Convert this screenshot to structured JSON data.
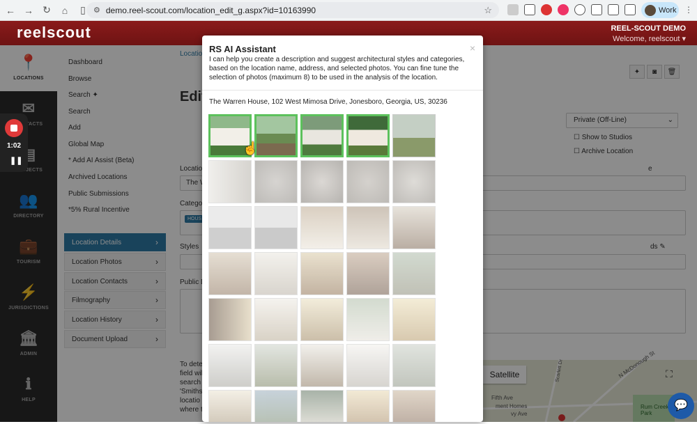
{
  "browser": {
    "url": "demo.reel-scout.com/location_edit_g.aspx?id=10163990",
    "profile_label": "Work"
  },
  "header": {
    "logo": "reelscout",
    "org": "REEL-SCOUT DEMO",
    "welcome": "Welcome, reelscout ▾"
  },
  "rail": [
    {
      "label": "LOCATIONS",
      "icon": "location-pin-icon"
    },
    {
      "label": "CONTACTS",
      "icon": "envelope-icon"
    },
    {
      "label": "PROJECTS",
      "icon": "projects-icon"
    },
    {
      "label": "DIRECTORY",
      "icon": "people-icon"
    },
    {
      "label": "TOURISM",
      "icon": "suitcase-icon"
    },
    {
      "label": "JURISDICTIONS",
      "icon": "lightning-icon"
    },
    {
      "label": "ADMIN",
      "icon": "building-icon"
    },
    {
      "label": "HELP",
      "icon": "info-icon"
    }
  ],
  "recorder": {
    "time": "1:02"
  },
  "sidebar": {
    "links": [
      "Dashboard",
      "Browse",
      "Search ✦",
      "Search",
      "Add",
      "Global Map",
      "* Add AI Assist (Beta)",
      "Archived Locations",
      "Public Submissions",
      "*5% Rural Incentive"
    ],
    "buttons": [
      "Location Details",
      "Location Photos",
      "Location Contacts",
      "Filmography",
      "Location History",
      "Document Upload"
    ]
  },
  "background": {
    "breadcrumb": "Locatio",
    "heading": "Edit",
    "status_select": "Private (Off-Line)",
    "show_studios": "Show to Studios",
    "archive": "Archive Location",
    "location_label": "Locatio",
    "location_value": "The W",
    "category_label": "Catego",
    "category_tag": "HOUS",
    "styles_label": "Styles",
    "public_label": "Public D",
    "name_label_frag": "e",
    "keywords_frag": "ds",
    "bottom_text": [
      "To dete",
      "field wil",
      "search",
      "'Smiths",
      "locatio",
      "where t"
    ]
  },
  "map": {
    "satellite": "Satellite",
    "street1": "N McDonough St",
    "street2": "Scarlett Dr",
    "street3": "Fifth Ave",
    "street4": "vy Ave",
    "place": "Rum Creek Park",
    "place2": "ment Homes"
  },
  "modal": {
    "title": "RS AI Assistant",
    "close": "×",
    "description": "I can help you create a description and suggest architectural styles and categories, based on the location name, address, and selected photos. You can fine tune the selection of photos (maximum 8) to be used in the analysis of the location.",
    "address": "The Warren House, 102 West Mimosa Drive, Jonesboro, Georgia, US, 30236"
  },
  "colors": {
    "header": "#7a1616",
    "sidebar_active": "#2e7ba6",
    "selected_border": "#5cc15c"
  }
}
